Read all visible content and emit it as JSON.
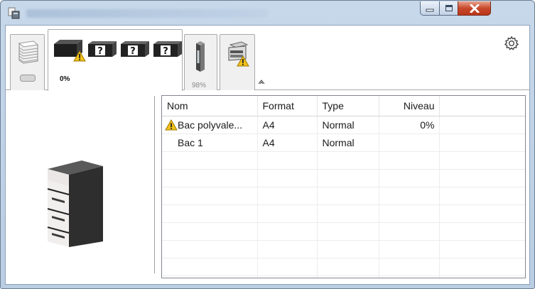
{
  "window": {
    "title": ""
  },
  "toolbar": {
    "cartridges_level": "0%",
    "toner_level": "98%"
  },
  "table": {
    "columns": [
      "Nom",
      "Format",
      "Type",
      "Niveau",
      ""
    ],
    "rows": [
      {
        "warning": true,
        "name": "Bac polyvale...",
        "format": "A4",
        "type": "Normal",
        "level": "0%"
      },
      {
        "warning": false,
        "name": "Bac 1",
        "format": "A4",
        "type": "Normal",
        "level": ""
      }
    ]
  },
  "colors": {
    "warning": "#f2c21b",
    "close_button": "#c8482c",
    "titlebar": "#c7d8ea"
  },
  "icons": [
    "app-printer-icon",
    "minimize-icon",
    "maximize-icon",
    "close-icon",
    "paper-stack-icon",
    "cartridge-warning-icon",
    "cartridge-unknown-icon",
    "toner-icon",
    "device-warning-icon",
    "collapse-icon",
    "gear-icon",
    "warning-icon"
  ]
}
